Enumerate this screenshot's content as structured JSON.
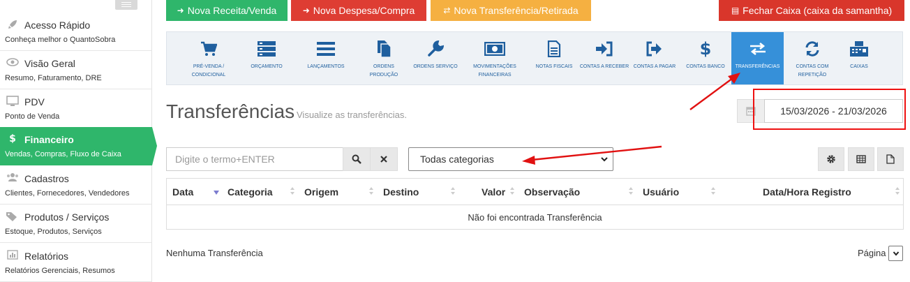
{
  "sidebar": {
    "items": [
      {
        "title": "Acesso Rápido",
        "subtitle": "Conheça melhor o QuantoSobra",
        "icon": "rocket-icon"
      },
      {
        "title": "Visão Geral",
        "subtitle": "Resumo, Faturamento, DRE",
        "icon": "eye-icon"
      },
      {
        "title": "PDV",
        "subtitle": "Ponto de Venda",
        "icon": "monitor-icon"
      },
      {
        "title": "Financeiro",
        "subtitle": "Vendas, Compras, Fluxo de Caixa",
        "icon": "dollar-icon"
      },
      {
        "title": "Cadastros",
        "subtitle": "Clientes, Fornecedores, Vendedores",
        "icon": "users-icon"
      },
      {
        "title": "Produtos / Serviços",
        "subtitle": "Estoque, Produtos, Serviços",
        "icon": "tags-icon"
      },
      {
        "title": "Relatórios",
        "subtitle": "Relatórios Gerenciais, Resumos",
        "icon": "bar-chart-icon"
      }
    ]
  },
  "top_buttons": {
    "nova_receita": "Nova Receita/Venda",
    "nova_despesa": "Nova Despesa/Compra",
    "nova_transferencia": "Nova Transferência/Retirada",
    "fechar_caixa": "Fechar Caixa (caixa da samantha)"
  },
  "nav": {
    "items": [
      {
        "label": "PRÉ-VENDA / CONDICIONAL",
        "icon": "cart-icon"
      },
      {
        "label": "ORÇAMENTO",
        "icon": "server-icon"
      },
      {
        "label": "LANÇAMENTOS",
        "icon": "list-icon"
      },
      {
        "label": "ORDENS PRODUÇÃO",
        "icon": "files-icon"
      },
      {
        "label": "ORDENS SERVIÇO",
        "icon": "wrench-icon"
      },
      {
        "label": "MOVIMENTAÇÕES FINANCEIRAS",
        "icon": "money-icon"
      },
      {
        "label": "NOTAS FISCAIS",
        "icon": "document-icon"
      },
      {
        "label": "CONTAS A RECEBER",
        "icon": "sign-in-icon"
      },
      {
        "label": "CONTAS A PAGAR",
        "icon": "sign-out-icon"
      },
      {
        "label": "CONTAS BANCO",
        "icon": "dollar-icon"
      },
      {
        "label": "TRANSFERÊNCIAS",
        "icon": "exchange-icon"
      },
      {
        "label": "CONTAS COM REPETIÇÃO",
        "icon": "refresh-icon"
      },
      {
        "label": "CAIXAS",
        "icon": "cash-register-icon"
      }
    ]
  },
  "page": {
    "title": "Transferências",
    "subtitle": "Visualize as transferências."
  },
  "date_range": {
    "value": "15/03/2026 - 21/03/2026"
  },
  "search": {
    "placeholder": "Digite o termo+ENTER"
  },
  "category_select": {
    "selected": "Todas categorias"
  },
  "table": {
    "columns": [
      "Data",
      "Categoria",
      "Origem",
      "Destino",
      "Valor",
      "Observação",
      "Usuário",
      "Data/Hora Registro"
    ],
    "empty_message": "Não foi encontrada Transferência"
  },
  "footer": {
    "summary": "Nenhuma Transferência",
    "page_label": "Página"
  },
  "colors": {
    "green": "#2fb66b",
    "red": "#de3d33",
    "orange": "#f5b041",
    "dark_red": "#d9362b",
    "nav_blue": "#1f5f9e",
    "active_blue": "#3690d9",
    "annotation_red": "#e11111"
  }
}
